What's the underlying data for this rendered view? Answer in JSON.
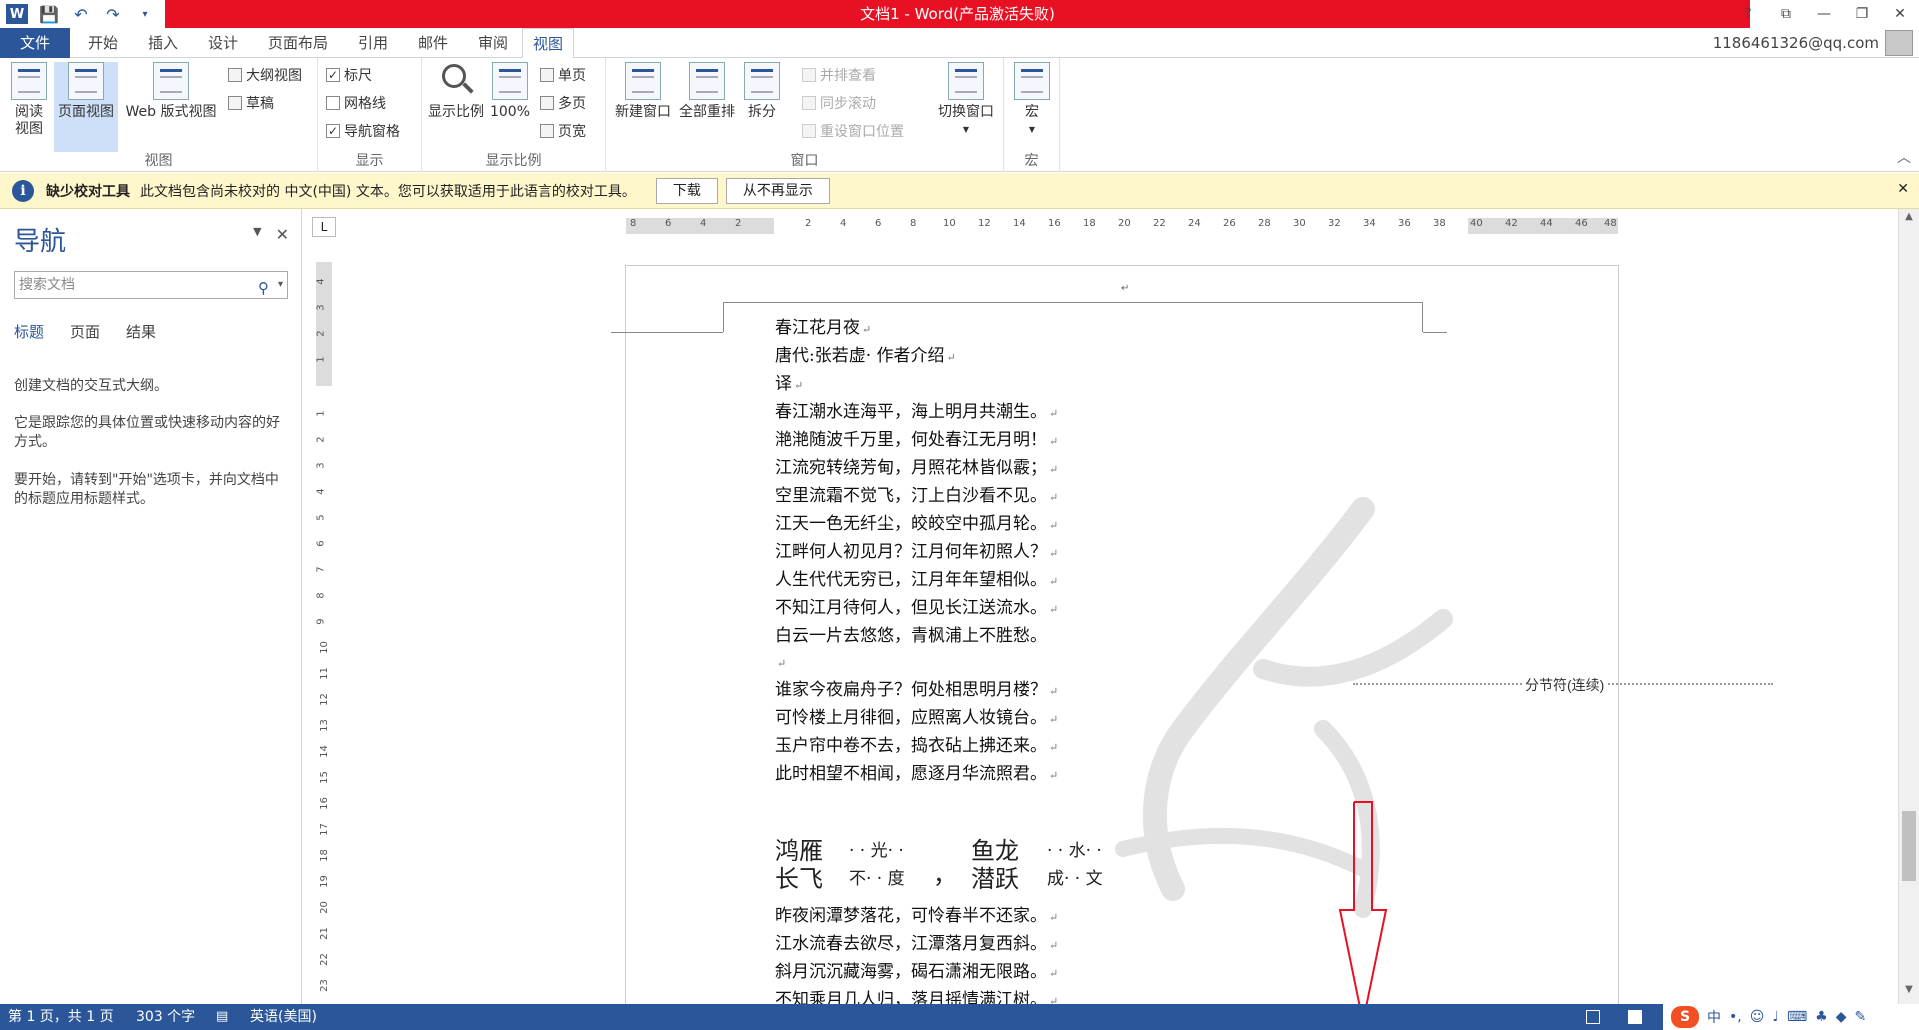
{
  "window": {
    "title": "文档1 - Word(产品激活失败)",
    "controls": [
      "?",
      "⧉",
      "—",
      "❐",
      "✕"
    ]
  },
  "qat": {
    "icons": [
      "word-app-icon",
      "save-icon",
      "undo-icon",
      "redo-icon",
      "customize-icon"
    ]
  },
  "tabs": {
    "file": "文件",
    "items": [
      "开始",
      "插入",
      "设计",
      "页面布局",
      "引用",
      "邮件",
      "审阅",
      "视图"
    ],
    "active": "视图",
    "account": "1186461326@qq.com"
  },
  "ribbon": {
    "views": {
      "group": "视图",
      "read": "阅读\n视图",
      "print": "页面视图",
      "web": "Web 版式视图",
      "outline": "大纲视图",
      "draft": "草稿"
    },
    "show": {
      "group": "显示",
      "ruler": "标尺",
      "gridlines": "网格线",
      "navpane": "导航窗格",
      "ruler_checked": true,
      "grid_checked": false,
      "nav_checked": true
    },
    "zoom": {
      "group": "显示比例",
      "zoom": "显示比例",
      "hundred": "100%",
      "one_page": "单页",
      "multi_page": "多页",
      "page_width": "页宽"
    },
    "window": {
      "group": "窗口",
      "new_window": "新建窗口",
      "arrange_all": "全部重排",
      "split": "拆分",
      "side_by_side": "并排查看",
      "sync_scroll": "同步滚动",
      "reset_pos": "重设窗口位置",
      "switch": "切换窗口"
    },
    "macros": {
      "group": "宏",
      "macros": "宏"
    }
  },
  "message_bar": {
    "title": "缺少校对工具",
    "text": "此文档包含尚未校对的 中文(中国) 文本。您可以获取适用于此语言的校对工具。",
    "download": "下载",
    "dont_show": "从不再显示"
  },
  "nav": {
    "title": "导航",
    "search_placeholder": "搜索文档",
    "tabs": [
      "标题",
      "页面",
      "结果"
    ],
    "para1": "创建文档的交互式大纲。",
    "para2": "它是跟踪您的具体位置或快速移动内容的好方式。",
    "para3": "要开始，请转到\"开始\"选项卡，并向文档中的标题应用标题样式。"
  },
  "ruler": {
    "h_ticks": [
      "8",
      "6",
      "4",
      "2",
      "2",
      "4",
      "6",
      "8",
      "10",
      "12",
      "14",
      "16",
      "18",
      "20",
      "22",
      "24",
      "26",
      "28",
      "30",
      "32",
      "34",
      "36",
      "38",
      "40",
      "42",
      "44",
      "46",
      "48"
    ],
    "v_ticks": [
      "4",
      "3",
      "2",
      "1",
      "1",
      "2",
      "3",
      "4",
      "5",
      "6",
      "7",
      "8",
      "9",
      "10",
      "11",
      "12",
      "13",
      "14",
      "15",
      "16",
      "17",
      "18",
      "19",
      "20",
      "21",
      "22",
      "23"
    ]
  },
  "document": {
    "lines_top": [
      "春江花月夜",
      "唐代:张若虚· 作者介绍",
      "译",
      "春江潮水连海平，海上明月共潮生。",
      "滟滟随波千万里，何处春江无月明！",
      "江流宛转绕芳甸，月照花林皆似霰；",
      "空里流霜不觉飞，汀上白沙看不见。",
      "江天一色无纤尘，皎皎空中孤月轮。",
      "江畔何人初见月？江月何年初照人？",
      "人生代代无穷已，江月年年望相似。",
      "不知江月待何人，但见长江送流水。",
      "白云一片去悠悠，青枫浦上不胜愁。"
    ],
    "section_break": "分节符(连续)",
    "lines_mid": [
      "谁家今夜扁舟子？何处相思明月楼？",
      "可怜楼上月徘徊，应照离人妆镜台。",
      "玉户帘中卷不去，捣衣砧上拂还来。",
      "此时相望不相闻，愿逐月华流照君。"
    ],
    "combined": {
      "a_top": "鸿雁",
      "a_bottom": "长飞",
      "b_top": "· · 光· ·",
      "b_bottom": "不· · 度",
      "c_top": "鱼龙",
      "c_bottom": "潜跃",
      "d_top": "· · 水· ·",
      "d_bottom": "成· · 文",
      "comma": "，"
    },
    "lines_bottom": [
      "昨夜闲潭梦落花，可怜春半不还家。",
      "江水流春去欲尽，江潭落月复西斜。",
      "斜月沉沉藏海雾，碣石潇湘无限路。",
      "不知乘月几人归，落月摇情满江树。"
    ]
  },
  "status": {
    "page": "第 1 页，共 1 页",
    "words": "303 个字",
    "lang": "英语(美国)",
    "ime_label": "中"
  }
}
